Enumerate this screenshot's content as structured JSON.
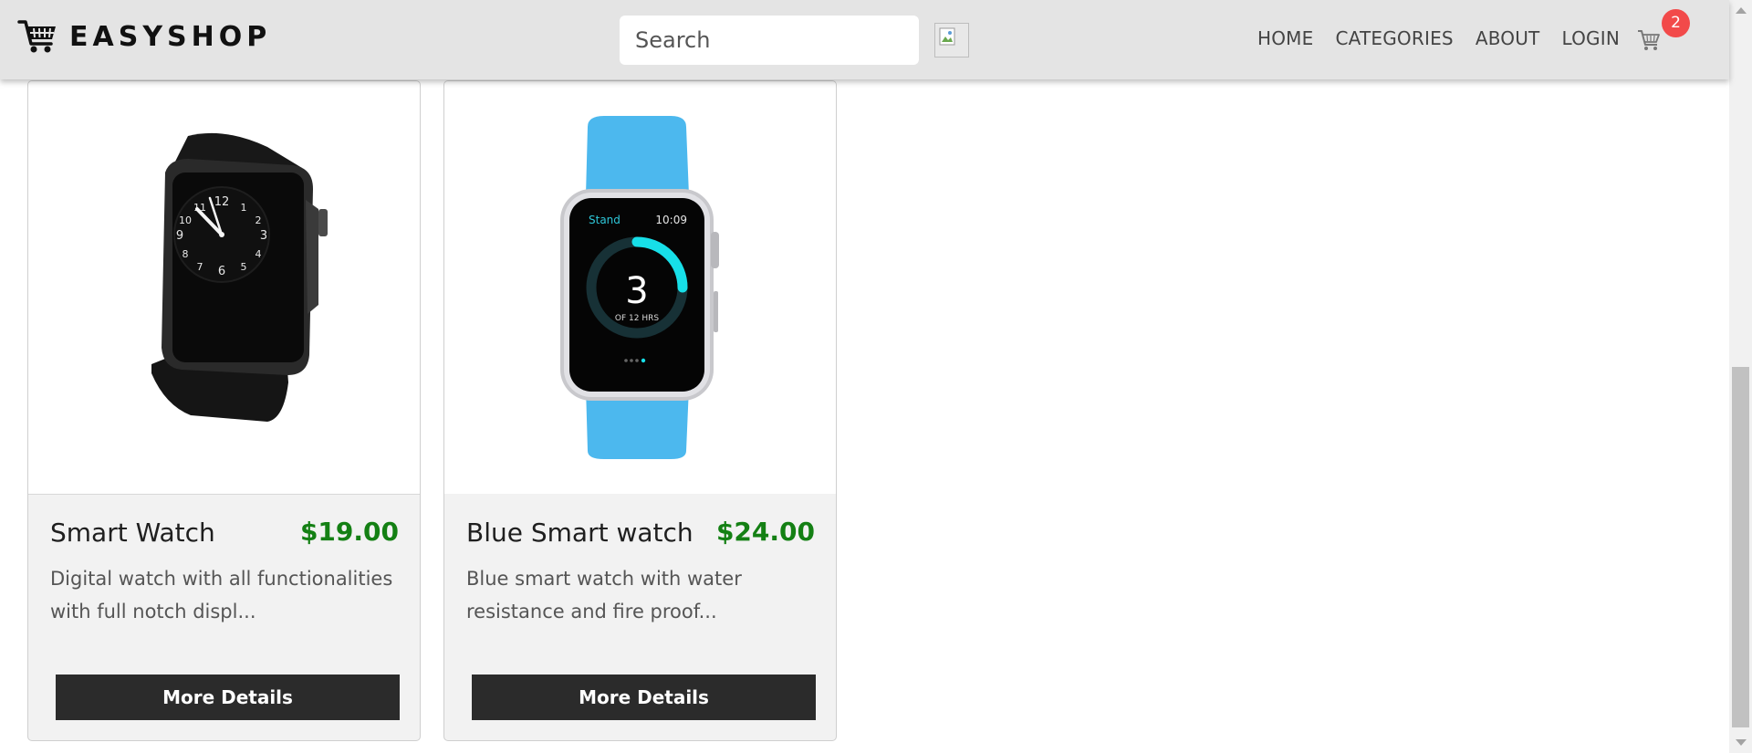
{
  "brand": {
    "name": "EASYSHOP",
    "icon": "shopping-cart-icon"
  },
  "search": {
    "placeholder": "Search",
    "value": "",
    "button_icon": "broken-image-icon"
  },
  "nav": {
    "links": [
      "HOME",
      "CATEGORIES",
      "ABOUT",
      "LOGIN"
    ]
  },
  "cart": {
    "icon": "cart-icon",
    "count": "2"
  },
  "products": [
    {
      "name": "Smart Watch",
      "price": "$19.00",
      "description": "Digital watch with all functionalities with full notch displ...",
      "button_label": "More Details",
      "image": "black-smart-watch"
    },
    {
      "name": "Blue Smart watch",
      "price": "$24.00",
      "description": "Blue smart watch with water resistance and fire proof...",
      "button_label": "More Details",
      "image": "blue-smart-watch",
      "watch_screen": {
        "label": "Stand",
        "time": "10:09",
        "value": "3",
        "unit": "OF 12 HRS",
        "progress": 0.25
      }
    }
  ],
  "colors": {
    "navbar_bg": "#e4e4e4",
    "price_green": "#148014",
    "button_dark": "#2b2b2b",
    "badge_red": "#f24a4a",
    "watch_band_blue": "#4cb8ee"
  }
}
